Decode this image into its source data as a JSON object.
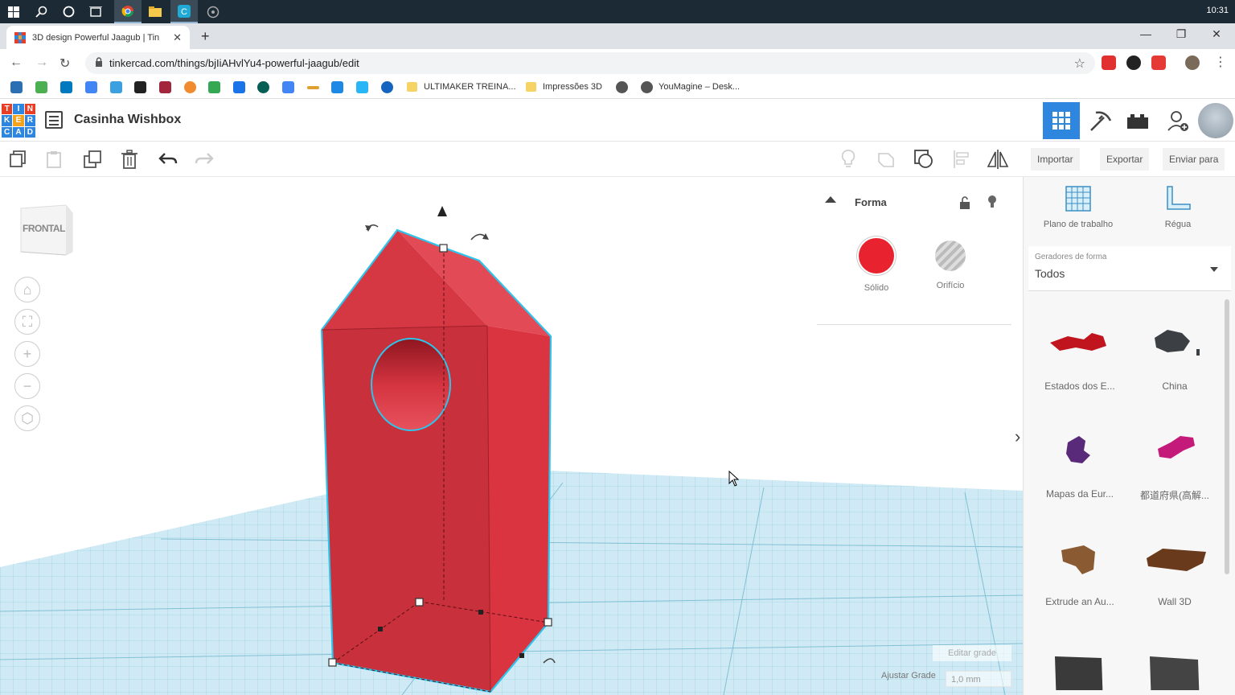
{
  "taskbar": {
    "clock": "10:31"
  },
  "browser": {
    "tab_title": "3D design Powerful Jaagub | Tin",
    "url": "tinkercad.com/things/bjIiAHvlYu4-powerful-jaagub/edit",
    "bookmarks": [
      "ULTIMAKER TREINA...",
      "Impressões 3D",
      "YouMagine – Desk..."
    ]
  },
  "app": {
    "logo_letters": [
      "T",
      "I",
      "N",
      "K",
      "E",
      "R",
      "C",
      "A",
      "D"
    ],
    "design_title": "Casinha Wishbox"
  },
  "actions": {
    "import": "Importar",
    "export": "Exportar",
    "send": "Enviar para"
  },
  "viewcube": {
    "label": "FRONTAL"
  },
  "shape_panel": {
    "title": "Forma",
    "solid_label": "Sólido",
    "hole_label": "Orifício",
    "solid_color": "#e8222f"
  },
  "grid": {
    "edit_label": "Editar grade",
    "snap_label": "Ajustar Grade",
    "snap_value": "1,0 mm"
  },
  "right_panel": {
    "workplane_label": "Plano de trabalho",
    "ruler_label": "Régua",
    "generators_label": "Geradores de forma",
    "generators_value": "Todos",
    "shapes": [
      {
        "name": "Estados dos E...",
        "color": "#c0141e"
      },
      {
        "name": "China",
        "color": "#3c3f44"
      },
      {
        "name": "Mapas da Eur...",
        "color": "#5a2a7a"
      },
      {
        "name": "都道府県(高解...",
        "color": "#c41a7a"
      },
      {
        "name": "Extrude an Au...",
        "color": "#8a5a32"
      },
      {
        "name": "Wall 3D",
        "color": "#6a3a1c"
      },
      {
        "name": "",
        "color": "#3a3a3a"
      },
      {
        "name": "",
        "color": "#444444"
      }
    ]
  }
}
